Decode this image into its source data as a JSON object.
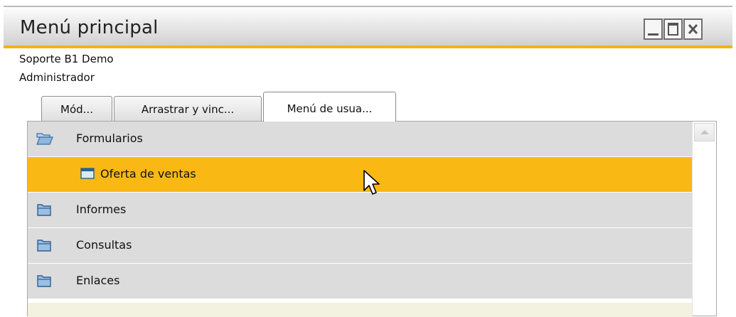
{
  "window": {
    "title": "Menú principal",
    "controls": [
      "minimize-icon",
      "maximize-icon",
      "close-icon"
    ],
    "accent_color": "#f2b417"
  },
  "user_info": {
    "company": "Soporte B1 Demo",
    "user": "Administrador"
  },
  "tabs": [
    {
      "label": "Mód...",
      "active": false
    },
    {
      "label": "Arrastrar y vinc...",
      "active": false
    },
    {
      "label": "Menú de usua...",
      "active": true
    }
  ],
  "menu_items": [
    {
      "label": "Formularios",
      "icon": "folder-open-icon",
      "level": 0,
      "selected": false
    },
    {
      "label": "Oferta de ventas",
      "icon": "form-window-icon",
      "level": 1,
      "selected": true
    },
    {
      "label": "Informes",
      "icon": "folder-icon",
      "level": 0,
      "selected": false
    },
    {
      "label": "Consultas",
      "icon": "folder-icon",
      "level": 0,
      "selected": false
    },
    {
      "label": "Enlaces",
      "icon": "folder-icon",
      "level": 0,
      "selected": false
    }
  ],
  "colors": {
    "selected_row": "#fab814",
    "row_background": "#dcdcdc",
    "empty_area": "#f3f1df"
  }
}
